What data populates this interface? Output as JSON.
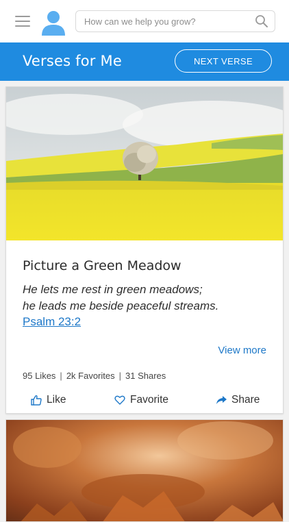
{
  "topbar": {
    "menu_icon": "hamburger-icon",
    "avatar_icon": "user-avatar-icon",
    "search": {
      "placeholder": "How can we help you grow?",
      "icon": "search-icon"
    }
  },
  "header": {
    "title": "Verses for Me",
    "next_button": "NEXT VERSE",
    "color": "#1f8be0"
  },
  "card": {
    "image": "yellow rapeseed field with a lone tree",
    "title": "Picture a Green Meadow",
    "verse_line1": "He lets me rest in green meadows;",
    "verse_line2": "he leads me beside peaceful streams.",
    "reference": "Psalm 23:2",
    "view_more": "View more",
    "stats": {
      "likes": "95 Likes",
      "favorites": "2k Favorites",
      "shares": "31 Shares"
    },
    "actions": {
      "like": "Like",
      "favorite": "Favorite",
      "share": "Share"
    },
    "accent": "#1e78c8"
  },
  "next_card": {
    "image": "autumn leaves"
  }
}
